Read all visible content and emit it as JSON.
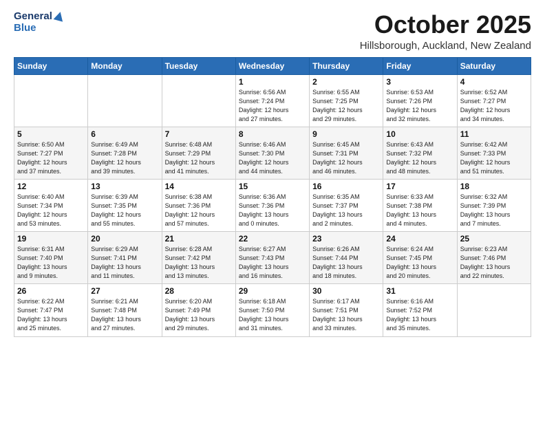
{
  "header": {
    "logo_general": "General",
    "logo_blue": "Blue",
    "month": "October 2025",
    "location": "Hillsborough, Auckland, New Zealand"
  },
  "days_of_week": [
    "Sunday",
    "Monday",
    "Tuesday",
    "Wednesday",
    "Thursday",
    "Friday",
    "Saturday"
  ],
  "weeks": [
    [
      {
        "day": "",
        "info": ""
      },
      {
        "day": "",
        "info": ""
      },
      {
        "day": "",
        "info": ""
      },
      {
        "day": "1",
        "info": "Sunrise: 6:56 AM\nSunset: 7:24 PM\nDaylight: 12 hours\nand 27 minutes."
      },
      {
        "day": "2",
        "info": "Sunrise: 6:55 AM\nSunset: 7:25 PM\nDaylight: 12 hours\nand 29 minutes."
      },
      {
        "day": "3",
        "info": "Sunrise: 6:53 AM\nSunset: 7:26 PM\nDaylight: 12 hours\nand 32 minutes."
      },
      {
        "day": "4",
        "info": "Sunrise: 6:52 AM\nSunset: 7:27 PM\nDaylight: 12 hours\nand 34 minutes."
      }
    ],
    [
      {
        "day": "5",
        "info": "Sunrise: 6:50 AM\nSunset: 7:27 PM\nDaylight: 12 hours\nand 37 minutes."
      },
      {
        "day": "6",
        "info": "Sunrise: 6:49 AM\nSunset: 7:28 PM\nDaylight: 12 hours\nand 39 minutes."
      },
      {
        "day": "7",
        "info": "Sunrise: 6:48 AM\nSunset: 7:29 PM\nDaylight: 12 hours\nand 41 minutes."
      },
      {
        "day": "8",
        "info": "Sunrise: 6:46 AM\nSunset: 7:30 PM\nDaylight: 12 hours\nand 44 minutes."
      },
      {
        "day": "9",
        "info": "Sunrise: 6:45 AM\nSunset: 7:31 PM\nDaylight: 12 hours\nand 46 minutes."
      },
      {
        "day": "10",
        "info": "Sunrise: 6:43 AM\nSunset: 7:32 PM\nDaylight: 12 hours\nand 48 minutes."
      },
      {
        "day": "11",
        "info": "Sunrise: 6:42 AM\nSunset: 7:33 PM\nDaylight: 12 hours\nand 51 minutes."
      }
    ],
    [
      {
        "day": "12",
        "info": "Sunrise: 6:40 AM\nSunset: 7:34 PM\nDaylight: 12 hours\nand 53 minutes."
      },
      {
        "day": "13",
        "info": "Sunrise: 6:39 AM\nSunset: 7:35 PM\nDaylight: 12 hours\nand 55 minutes."
      },
      {
        "day": "14",
        "info": "Sunrise: 6:38 AM\nSunset: 7:36 PM\nDaylight: 12 hours\nand 57 minutes."
      },
      {
        "day": "15",
        "info": "Sunrise: 6:36 AM\nSunset: 7:36 PM\nDaylight: 13 hours\nand 0 minutes."
      },
      {
        "day": "16",
        "info": "Sunrise: 6:35 AM\nSunset: 7:37 PM\nDaylight: 13 hours\nand 2 minutes."
      },
      {
        "day": "17",
        "info": "Sunrise: 6:33 AM\nSunset: 7:38 PM\nDaylight: 13 hours\nand 4 minutes."
      },
      {
        "day": "18",
        "info": "Sunrise: 6:32 AM\nSunset: 7:39 PM\nDaylight: 13 hours\nand 7 minutes."
      }
    ],
    [
      {
        "day": "19",
        "info": "Sunrise: 6:31 AM\nSunset: 7:40 PM\nDaylight: 13 hours\nand 9 minutes."
      },
      {
        "day": "20",
        "info": "Sunrise: 6:29 AM\nSunset: 7:41 PM\nDaylight: 13 hours\nand 11 minutes."
      },
      {
        "day": "21",
        "info": "Sunrise: 6:28 AM\nSunset: 7:42 PM\nDaylight: 13 hours\nand 13 minutes."
      },
      {
        "day": "22",
        "info": "Sunrise: 6:27 AM\nSunset: 7:43 PM\nDaylight: 13 hours\nand 16 minutes."
      },
      {
        "day": "23",
        "info": "Sunrise: 6:26 AM\nSunset: 7:44 PM\nDaylight: 13 hours\nand 18 minutes."
      },
      {
        "day": "24",
        "info": "Sunrise: 6:24 AM\nSunset: 7:45 PM\nDaylight: 13 hours\nand 20 minutes."
      },
      {
        "day": "25",
        "info": "Sunrise: 6:23 AM\nSunset: 7:46 PM\nDaylight: 13 hours\nand 22 minutes."
      }
    ],
    [
      {
        "day": "26",
        "info": "Sunrise: 6:22 AM\nSunset: 7:47 PM\nDaylight: 13 hours\nand 25 minutes."
      },
      {
        "day": "27",
        "info": "Sunrise: 6:21 AM\nSunset: 7:48 PM\nDaylight: 13 hours\nand 27 minutes."
      },
      {
        "day": "28",
        "info": "Sunrise: 6:20 AM\nSunset: 7:49 PM\nDaylight: 13 hours\nand 29 minutes."
      },
      {
        "day": "29",
        "info": "Sunrise: 6:18 AM\nSunset: 7:50 PM\nDaylight: 13 hours\nand 31 minutes."
      },
      {
        "day": "30",
        "info": "Sunrise: 6:17 AM\nSunset: 7:51 PM\nDaylight: 13 hours\nand 33 minutes."
      },
      {
        "day": "31",
        "info": "Sunrise: 6:16 AM\nSunset: 7:52 PM\nDaylight: 13 hours\nand 35 minutes."
      },
      {
        "day": "",
        "info": ""
      }
    ]
  ]
}
